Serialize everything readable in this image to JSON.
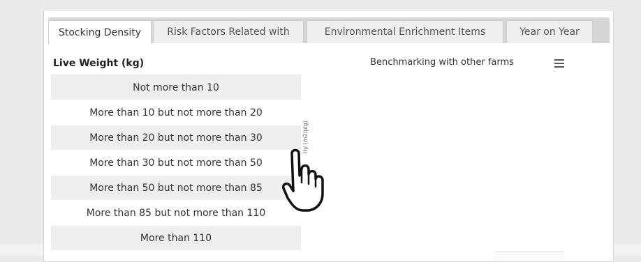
{
  "tabs": [
    {
      "label": "Stocking Density"
    },
    {
      "label": "Risk Factors Related with"
    },
    {
      "label": "Environmental Enrichment Items"
    },
    {
      "label": "Year on Year"
    }
  ],
  "table": {
    "header": "Live Weight (kg)",
    "rows": [
      "Not more than 10",
      "More than 10 but not more than 20",
      "More than 20 but not more than 30",
      "More than 30 but not more than 50",
      "More than 50 but not more than 85",
      "More than 85 but not more than 110",
      "More than 110"
    ]
  },
  "chart": {
    "title": "Benchmarking with other farms",
    "axis_label": "ity (m2/pig)"
  },
  "icons": {
    "menu": "hamburger-menu-icon",
    "cursor": "hand-pointer-icon"
  },
  "colors": {
    "tabbar": "#d6d6d6",
    "row_alt": "#eeeeee"
  }
}
